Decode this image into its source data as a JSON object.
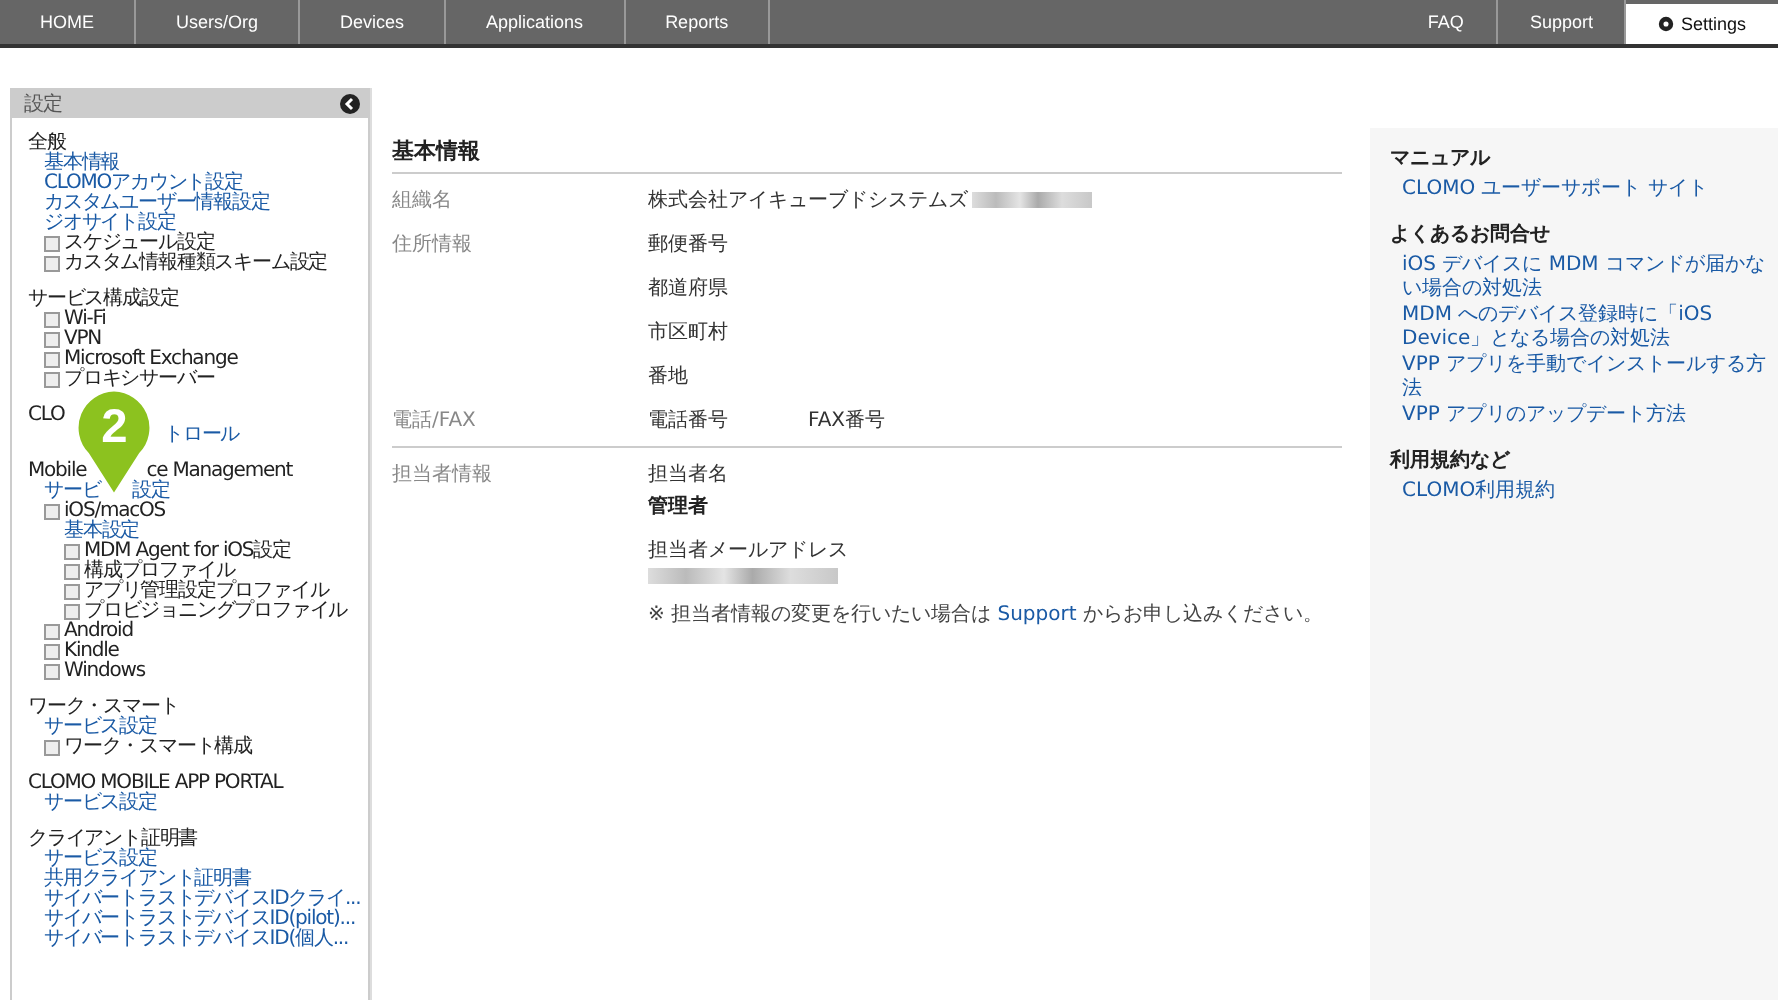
{
  "nav": {
    "left": [
      {
        "label": "HOME",
        "selected": false
      },
      {
        "label": "Users/Org",
        "selected": false
      },
      {
        "label": "Devices",
        "selected": false
      },
      {
        "label": "Applications",
        "selected": false
      },
      {
        "label": "Reports",
        "selected": false
      }
    ],
    "right": [
      {
        "label": "FAQ",
        "selected": false
      },
      {
        "label": "Support",
        "selected": false
      },
      {
        "label": "Settings",
        "selected": true
      }
    ]
  },
  "sidebar": {
    "title": "設定",
    "groups": [
      {
        "title": "全般",
        "items": [
          {
            "kind": "link",
            "text": "基本情報"
          },
          {
            "kind": "link",
            "text": "CLOMOアカウント設定"
          },
          {
            "kind": "link",
            "text": "カスタムユーザー情報設定"
          },
          {
            "kind": "link",
            "text": "ジオサイト設定"
          },
          {
            "kind": "folder",
            "text": "スケジュール設定"
          },
          {
            "kind": "folder",
            "text": "カスタム情報種類スキーム設定"
          }
        ]
      },
      {
        "title": "サービス構成設定",
        "items": [
          {
            "kind": "folder",
            "text": "Wi-Fi"
          },
          {
            "kind": "folder",
            "text": "VPN"
          },
          {
            "kind": "folder",
            "text": "Microsoft Exchange"
          },
          {
            "kind": "folder",
            "text": "プロキシサーバー"
          }
        ]
      },
      {
        "title": "CLO",
        "pin": "2",
        "items": [
          {
            "kind": "link",
            "tail": "トロール"
          }
        ]
      },
      {
        "title": "Mobile",
        "title_tail": "ce Management",
        "items": [
          {
            "kind": "link",
            "text": "サービ",
            "tail": "設定"
          },
          {
            "kind": "folder",
            "text": "iOS/macOS",
            "children": [
              {
                "kind": "link",
                "text": "基本設定"
              },
              {
                "kind": "folder",
                "text": "MDM Agent for iOS設定"
              },
              {
                "kind": "folder",
                "text": "構成プロファイル"
              },
              {
                "kind": "folder",
                "text": "アプリ管理設定プロファイル"
              },
              {
                "kind": "folder",
                "text": "プロビジョニングプロファイル"
              }
            ]
          },
          {
            "kind": "folder",
            "text": "Android"
          },
          {
            "kind": "folder",
            "text": "Kindle"
          },
          {
            "kind": "folder",
            "text": "Windows"
          }
        ]
      },
      {
        "title": "ワーク・スマート",
        "items": [
          {
            "kind": "link",
            "text": "サービス設定"
          },
          {
            "kind": "folder",
            "text": "ワーク・スマート構成"
          }
        ]
      },
      {
        "title": "CLOMO MOBILE APP PORTAL",
        "items": [
          {
            "kind": "link",
            "text": "サービス設定"
          }
        ]
      },
      {
        "title": "クライアント証明書",
        "items": [
          {
            "kind": "link",
            "text": "サービス設定"
          },
          {
            "kind": "link",
            "text": "共用クライアント証明書"
          },
          {
            "kind": "link",
            "text": "サイバートラストデバイスIDクライ..."
          },
          {
            "kind": "link",
            "text": "サイバートラストデバイスID(pilot)..."
          },
          {
            "kind": "link",
            "text": "サイバートラストデバイスID(個人..."
          }
        ]
      }
    ]
  },
  "main": {
    "title": "基本情報",
    "rows": [
      {
        "label": "組織名",
        "kind": "stack",
        "fields": [
          {
            "kind": "caption",
            "text": "株式会社アイキューブドシステムズ",
            "redacted": true
          }
        ]
      },
      {
        "label": "住所情報",
        "kind": "stack",
        "fields": [
          {
            "kind": "caption",
            "text": "郵便番号"
          },
          {
            "kind": "caption",
            "text": "都道府県"
          },
          {
            "kind": "caption",
            "text": "市区町村"
          },
          {
            "kind": "caption",
            "text": "番地"
          }
        ]
      },
      {
        "label": "電話/FAX",
        "kind": "inline",
        "fields": [
          {
            "kind": "caption",
            "text": "電話番号"
          },
          {
            "kind": "caption",
            "text": "FAX番号"
          }
        ]
      },
      {
        "label": "担当者情報",
        "kind": "stack",
        "fields": [
          {
            "kind": "caption",
            "text": "担当者名"
          },
          {
            "kind": "value",
            "text": "管理者"
          },
          {
            "kind": "caption",
            "text": "担当者メールアドレス"
          },
          {
            "kind": "redaction"
          },
          {
            "kind": "note",
            "before": "※ 担当者情報の変更を行いたい場合は ",
            "link": "Support",
            "after": " からお申し込みください。"
          }
        ]
      }
    ]
  },
  "help": [
    {
      "heading": "マニュアル",
      "links": [
        "CLOMO ユーザーサポート サイト"
      ]
    },
    {
      "heading": "よくあるお問合せ",
      "links": [
        "iOS デバイスに MDM コマンドが届かない場合の対処法",
        "MDM へのデバイス登録時に「iOS Device」となる場合の対処法",
        "VPP アプリを手動でインストールする方法",
        "VPP アプリのアップデート方法"
      ]
    },
    {
      "heading": "利用規約など",
      "links": [
        "CLOMO利用規約"
      ]
    }
  ]
}
